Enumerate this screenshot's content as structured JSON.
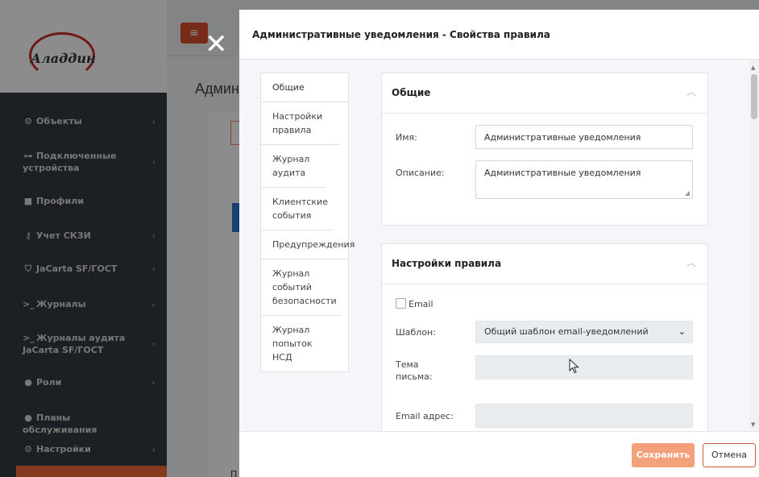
{
  "background": {
    "logo_text": "Аладдин",
    "page_title": "Админ",
    "content_label": "П",
    "sidebar_items": [
      {
        "icon": "objects-icon",
        "glyph": "⚙",
        "label": "Объекты",
        "chevron": true
      },
      {
        "icon": "devices-icon",
        "glyph": "⊶",
        "label": "Подключенные устройства",
        "chevron": true
      },
      {
        "icon": "folder-icon",
        "glyph": "■",
        "label": "Профили",
        "chevron": false
      },
      {
        "icon": "key-icon",
        "glyph": "⚷",
        "label": "Учет СКЗИ",
        "chevron": true
      },
      {
        "icon": "shield-icon",
        "glyph": "⛉",
        "label": "JaCarta SF/ГОСТ",
        "chevron": true
      },
      {
        "icon": "terminal-icon",
        "glyph": ">_",
        "label": "Журналы",
        "chevron": true
      },
      {
        "icon": "terminal-icon",
        "glyph": ">_",
        "label": "Журналы аудита JaCarta SF/ГОСТ",
        "chevron": true
      },
      {
        "icon": "user-icon",
        "glyph": "●",
        "label": "Роли",
        "chevron": true
      },
      {
        "icon": "user-icon",
        "glyph": "●",
        "label": "Планы обслуживания",
        "chevron": false
      },
      {
        "icon": "settings-icon",
        "glyph": "⚙",
        "label": "Настройки",
        "chevron": true
      }
    ]
  },
  "modal": {
    "title": "Административные уведомления - Свойства правила",
    "tabs": [
      {
        "label": "Общие"
      },
      {
        "label": "Настройки правила"
      },
      {
        "label": "Журнал аудита"
      },
      {
        "label": "Клиентские события"
      },
      {
        "label": "Предупреждения"
      },
      {
        "label": "Журнал событий безопасности"
      },
      {
        "label": "Журнал попыток НСД"
      }
    ],
    "general": {
      "title": "Общие",
      "name_label": "Имя:",
      "name_value": "Административные уведомления",
      "description_label": "Описание:",
      "description_value": "Административные уведомления"
    },
    "rule_settings": {
      "title": "Настройки правила",
      "email_label": "Email",
      "email_checked": false,
      "template_label": "Шаблон:",
      "template_value": "Общий шаблон email-уведомлений",
      "subject_label": "Тема письма:",
      "subject_value": "",
      "email_address_label": "Email адрес:",
      "email_address_value": ""
    },
    "footer": {
      "save_label": "Сохранить",
      "cancel_label": "Отмена"
    }
  },
  "colors": {
    "accent": "#f26b3a",
    "save_button": "#f4a07b",
    "sidebar": "#343a40"
  }
}
